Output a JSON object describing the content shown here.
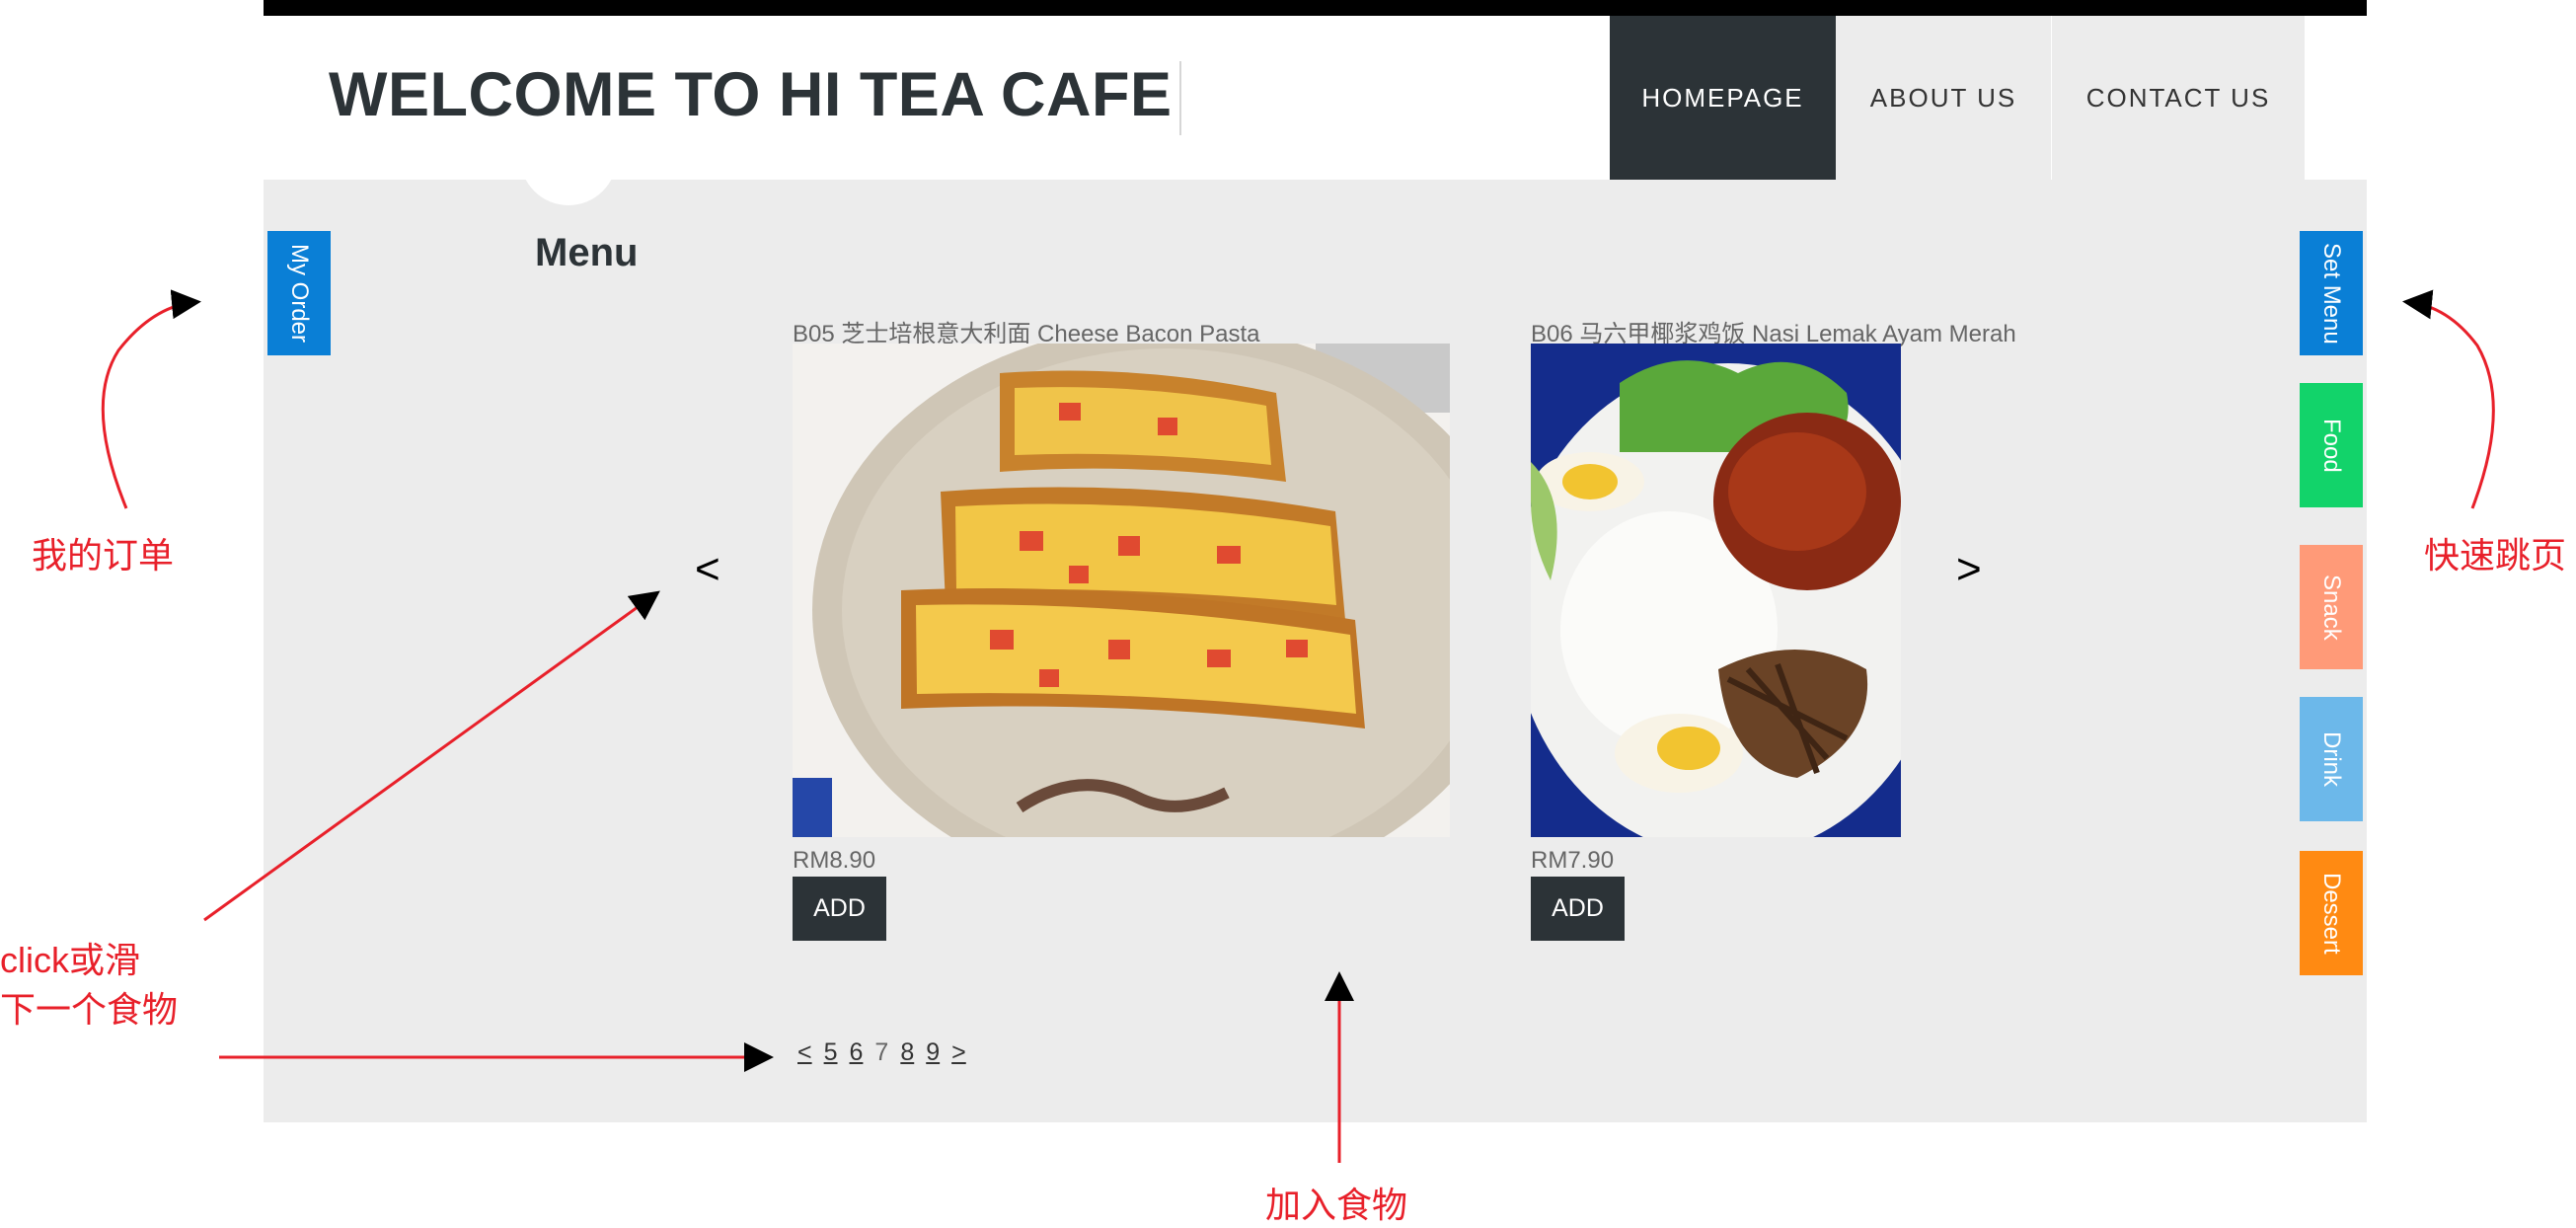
{
  "header": {
    "title": "WELCOME TO HI TEA CAFE",
    "nav": [
      "HOMEPAGE",
      "ABOUT US",
      "CONTACT US"
    ]
  },
  "sidebar_left": {
    "my_order": "My Order"
  },
  "sidebar_right": {
    "tabs": [
      {
        "label": "Set Menu",
        "color": "#0a7fd6"
      },
      {
        "label": "Food",
        "color": "#12d36a"
      },
      {
        "label": "Snack",
        "color": "#ff9a78"
      },
      {
        "label": "Drink",
        "color": "#6cb8ea"
      },
      {
        "label": "Dessert",
        "color": "#ff8a12"
      }
    ]
  },
  "my_order_color": "#0a7fd6",
  "menu": {
    "heading": "Menu",
    "prev": "<",
    "next": ">",
    "items": [
      {
        "name": "B05 芝士培根意大利面 Cheese Bacon Pasta",
        "price": "RM8.90",
        "add_label": "ADD"
      },
      {
        "name": "B06 马六甲椰浆鸡饭 Nasi Lemak Ayam Merah",
        "price": "RM7.90",
        "add_label": "ADD"
      }
    ],
    "pagination": [
      "<",
      "5",
      "6",
      "7",
      "8",
      "9",
      ">"
    ],
    "current_page": "7"
  },
  "annotations": {
    "my_order": "我的订单",
    "quick_jump": "快速跳页",
    "swipe_line1": "click或滑",
    "swipe_line2": "下一个食物",
    "add_food": "加入食物"
  }
}
